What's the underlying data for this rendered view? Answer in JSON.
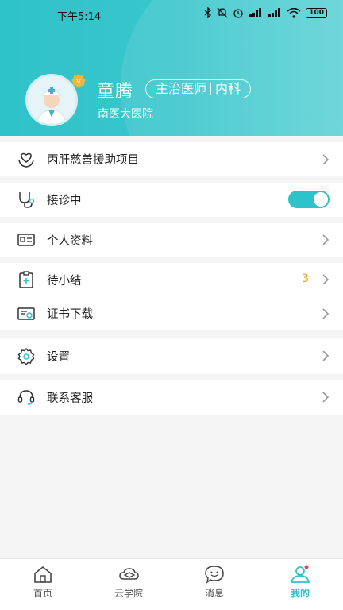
{
  "status_bar": {
    "time": "下午5:14",
    "battery": "100",
    "icons": [
      "bluetooth-icon",
      "mute-icon",
      "alarm-icon",
      "signal-icon",
      "signal-icon",
      "wifi-icon",
      "battery-icon"
    ]
  },
  "profile": {
    "name": "童腾",
    "title": "主治医师",
    "department": "内科",
    "hospital": "南医大医院",
    "badge": "V"
  },
  "menu": {
    "charity": {
      "label": "丙肝慈善援助项目",
      "icon": "heart-hand-icon"
    },
    "consult": {
      "label": "接诊中",
      "icon": "stethoscope-icon",
      "toggle_on": true
    },
    "profile_info": {
      "label": "个人资料",
      "icon": "id-card-icon"
    },
    "pending": {
      "label": "待小结",
      "icon": "clipboard-plus-icon",
      "count": "3"
    },
    "certificate": {
      "label": "证书下载",
      "icon": "certificate-icon"
    },
    "settings": {
      "label": "设置",
      "icon": "gear-icon"
    },
    "service": {
      "label": "联系客服",
      "icon": "headset-icon"
    }
  },
  "tabbar": {
    "tabs": [
      {
        "label": "首页",
        "icon": "home-icon"
      },
      {
        "label": "云学院",
        "icon": "cloud-academy-icon"
      },
      {
        "label": "消息",
        "icon": "message-icon"
      },
      {
        "label": "我的",
        "icon": "user-icon",
        "active": true
      }
    ]
  },
  "colors": {
    "accent": "#2ec3c9",
    "count": "#e3a21a",
    "background": "#f5f5f5"
  }
}
